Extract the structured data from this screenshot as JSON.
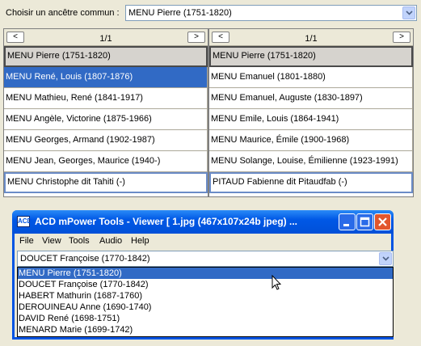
{
  "top": {
    "label": "Choisir un ancêtre commun :",
    "selected": "MENU Pierre (1751-1820)"
  },
  "left_panel": {
    "prev": "<",
    "next": ">",
    "page": "1/1",
    "rows": [
      "MENU Pierre (1751-1820)",
      "MENU René, Louis (1807-1876)",
      "MENU Mathieu, René (1841-1917)",
      "MENU Angèle, Victorine (1875-1966)",
      "MENU Georges, Armand (1902-1987)",
      "MENU Jean, Georges, Maurice (1940-)",
      "MENU Christophe dit Tahiti (-)"
    ]
  },
  "right_panel": {
    "prev": "<",
    "next": ">",
    "page": "1/1",
    "rows": [
      "MENU Pierre (1751-1820)",
      "MENU Emanuel (1801-1880)",
      "MENU Emanuel, Auguste (1830-1897)",
      "MENU Emile, Louis (1864-1941)",
      "MENU Maurice, Émile (1900-1968)",
      "MENU Solange, Louise, Émilienne (1923-1991)",
      "PITAUD Fabienne dit Pitaudfab (-)"
    ]
  },
  "window": {
    "title": "ACD mPower Tools - Viewer [ 1.jpg (467x107x24b jpeg) ...",
    "icon_text": "ACD",
    "menu": [
      "File",
      "View",
      "Tools",
      "Audio",
      "Help"
    ],
    "selected": "DOUCET Françoise (1770-1842)",
    "options": [
      "MENU Pierre (1751-1820)",
      "DOUCET Françoise (1770-1842)",
      "HABERT Mathurin (1687-1760)",
      "DEROUINEAU Anne (1690-1740)",
      "DAVID René (1698-1751)",
      "MENARD Marie (1699-1742)"
    ]
  },
  "colors": {
    "selection": "#316ac5",
    "titlebar": "#0058e6",
    "face": "#ece9d8"
  }
}
